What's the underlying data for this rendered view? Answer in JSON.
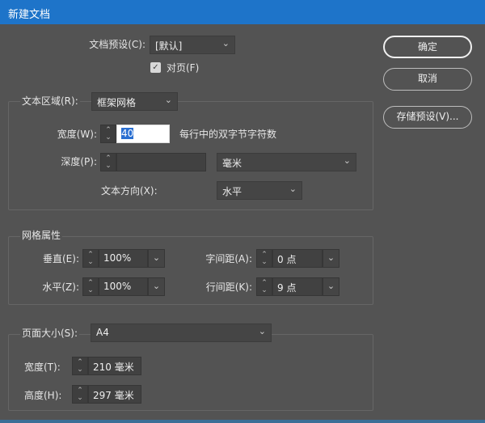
{
  "title": "新建文档",
  "preset": {
    "label": "文档预设(C):",
    "value": "[默认]"
  },
  "facing": {
    "label": "对页(F)",
    "checked": true
  },
  "buttons": {
    "ok": "确定",
    "cancel": "取消",
    "save_preset": "存储预设(V)..."
  },
  "text_area": {
    "label": "文本区域(R):",
    "value": "框架网格",
    "width": {
      "label": "宽度(W):",
      "value": "40",
      "suffix": "每行中的双字节字符数"
    },
    "depth": {
      "label": "深度(P):",
      "value": "",
      "unit": "毫米"
    },
    "direction": {
      "label": "文本方向(X):",
      "value": "水平"
    }
  },
  "grid": {
    "title": "网格属性",
    "vertical": {
      "label": "垂直(E):",
      "value": "100%"
    },
    "horizontal": {
      "label": "水平(Z):",
      "value": "100%"
    },
    "char_spacing": {
      "label": "字间距(A):",
      "value": "0 点"
    },
    "line_spacing": {
      "label": "行间距(K):",
      "value": "9 点"
    }
  },
  "page_size": {
    "label": "页面大小(S):",
    "value": "A4",
    "width": {
      "label": "宽度(T):",
      "value": "210 毫米"
    },
    "height": {
      "label": "高度(H):",
      "value": "297 毫米"
    }
  }
}
